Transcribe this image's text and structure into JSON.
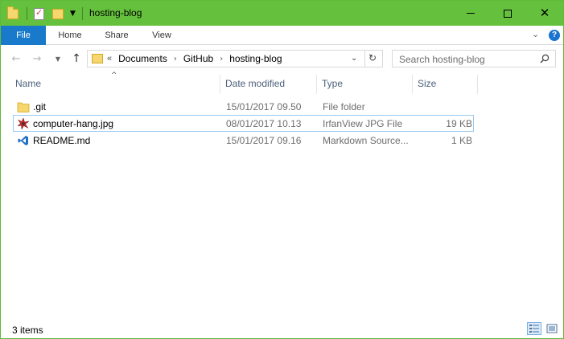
{
  "window": {
    "title": "hosting-blog"
  },
  "quick_access_toolbar": {
    "icons": [
      "folder-icon",
      "properties-icon",
      "new-folder-icon",
      "customize-dropdown-icon"
    ]
  },
  "window_controls": {
    "minimize_icon": "minimize-icon",
    "maximize_icon": "maximize-icon",
    "close_icon": "close-icon"
  },
  "ribbon": {
    "tabs": [
      {
        "label": "File",
        "active": true
      },
      {
        "label": "Home",
        "active": false
      },
      {
        "label": "Share",
        "active": false
      },
      {
        "label": "View",
        "active": false
      }
    ],
    "help_label": "?"
  },
  "navigation": {
    "back_icon": "back-arrow-icon",
    "forward_icon": "forward-arrow-icon",
    "up_icon": "up-arrow-icon",
    "overflow": "«",
    "breadcrumbs": [
      "Documents",
      "GitHub",
      "hosting-blog"
    ],
    "search_placeholder": "Search hosting-blog"
  },
  "columns": {
    "name": "Name",
    "date_modified": "Date modified",
    "type": "Type",
    "size": "Size",
    "sort_indicator": "^"
  },
  "files": [
    {
      "name": ".git",
      "date_modified": "15/01/2017 09.50",
      "type": "File folder",
      "size": "",
      "icon": "folder-icon",
      "selected": false
    },
    {
      "name": "computer-hang.jpg",
      "date_modified": "08/01/2017 10.13",
      "type": "IrfanView JPG File",
      "size": "19 KB",
      "icon": "irfanview-icon",
      "selected": true
    },
    {
      "name": "README.md",
      "date_modified": "15/01/2017 09.16",
      "type": "Markdown Source...",
      "size": "1 KB",
      "icon": "vscode-icon",
      "selected": false
    }
  ],
  "status": {
    "item_count": "3 items"
  },
  "colors": {
    "titlebar": "#65c13d",
    "file_tab": "#1979ca",
    "selection_border": "#99c9ef",
    "column_header_text": "#4c607a"
  }
}
